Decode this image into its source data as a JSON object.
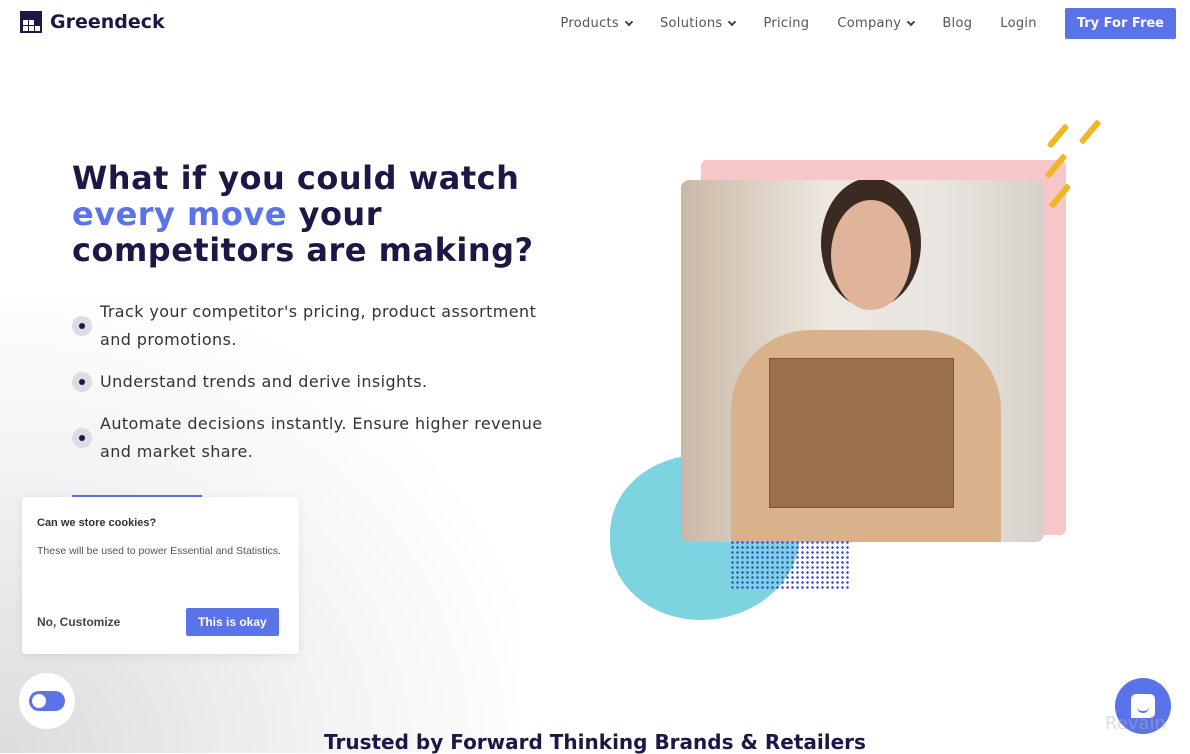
{
  "brand": {
    "name": "Greendeck"
  },
  "nav": {
    "items": [
      {
        "label": "Products",
        "dropdown": true
      },
      {
        "label": "Solutions",
        "dropdown": true
      },
      {
        "label": "Pricing",
        "dropdown": false
      },
      {
        "label": "Company",
        "dropdown": true
      },
      {
        "label": "Blog",
        "dropdown": false
      },
      {
        "label": "Login",
        "dropdown": false
      }
    ],
    "cta": "Try For Free"
  },
  "hero": {
    "title_part1": "What if you could watch",
    "title_highlight": "every move",
    "title_part2": "your competitors are making?",
    "bullets": [
      "Track your competitor's pricing, product assortment and promotions.",
      "Understand trends and derive insights.",
      "Automate decisions instantly. Ensure higher revenue and market share."
    ]
  },
  "cookie": {
    "title": "Can we store cookies?",
    "body": "These will be used to power Essential and Statistics.",
    "decline": "No, Customize",
    "accept": "This is okay"
  },
  "trusted": "Trusted by Forward Thinking Brands & Retailers",
  "watermark": "Revain",
  "colors": {
    "accent": "#5b73e8",
    "dark": "#1f1646"
  }
}
